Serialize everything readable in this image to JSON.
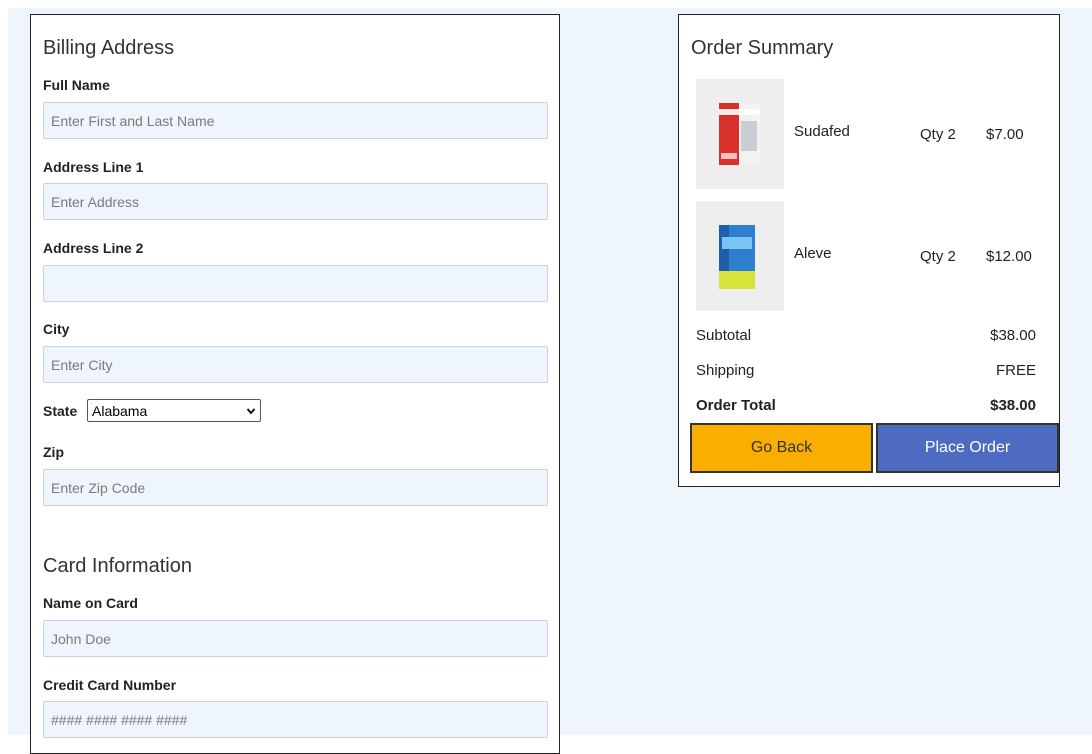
{
  "billing": {
    "title": "Billing Address",
    "full_name": {
      "label": "Full Name",
      "placeholder": "Enter First and Last Name",
      "value": ""
    },
    "address1": {
      "label": "Address Line 1",
      "placeholder": "Enter Address",
      "value": ""
    },
    "address2": {
      "label": "Address Line 2",
      "placeholder": "",
      "value": ""
    },
    "city": {
      "label": "City",
      "placeholder": "Enter City",
      "value": ""
    },
    "state": {
      "label": "State",
      "selected": "Alabama"
    },
    "zip": {
      "label": "Zip",
      "placeholder": "Enter Zip Code",
      "value": ""
    }
  },
  "card": {
    "title": "Card Information",
    "name_on_card": {
      "label": "Name on Card",
      "placeholder": "John Doe",
      "value": ""
    },
    "card_number": {
      "label": "Credit Card Number",
      "placeholder": "#### #### #### ####",
      "value": ""
    }
  },
  "summary": {
    "title": "Order Summary",
    "items": [
      {
        "name": "Sudafed",
        "qty": "Qty 2",
        "price": "$7.00",
        "thumb_color": "#d9302a"
      },
      {
        "name": "Aleve",
        "qty": "Qty 2",
        "price": "$12.00",
        "thumb_color": "#2f7fd1"
      }
    ],
    "subtotal_label": "Subtotal",
    "subtotal_value": "$38.00",
    "shipping_label": "Shipping",
    "shipping_value": "FREE",
    "total_label": "Order Total",
    "total_value": "$38.00",
    "back_label": "Go Back",
    "place_label": "Place Order"
  },
  "colors": {
    "page_bg": "#eef5fd",
    "go_back": "#f9ae00",
    "place_order": "#4e6bc2"
  },
  "icons": {
    "state_dropdown": "chevron-down-icon"
  }
}
